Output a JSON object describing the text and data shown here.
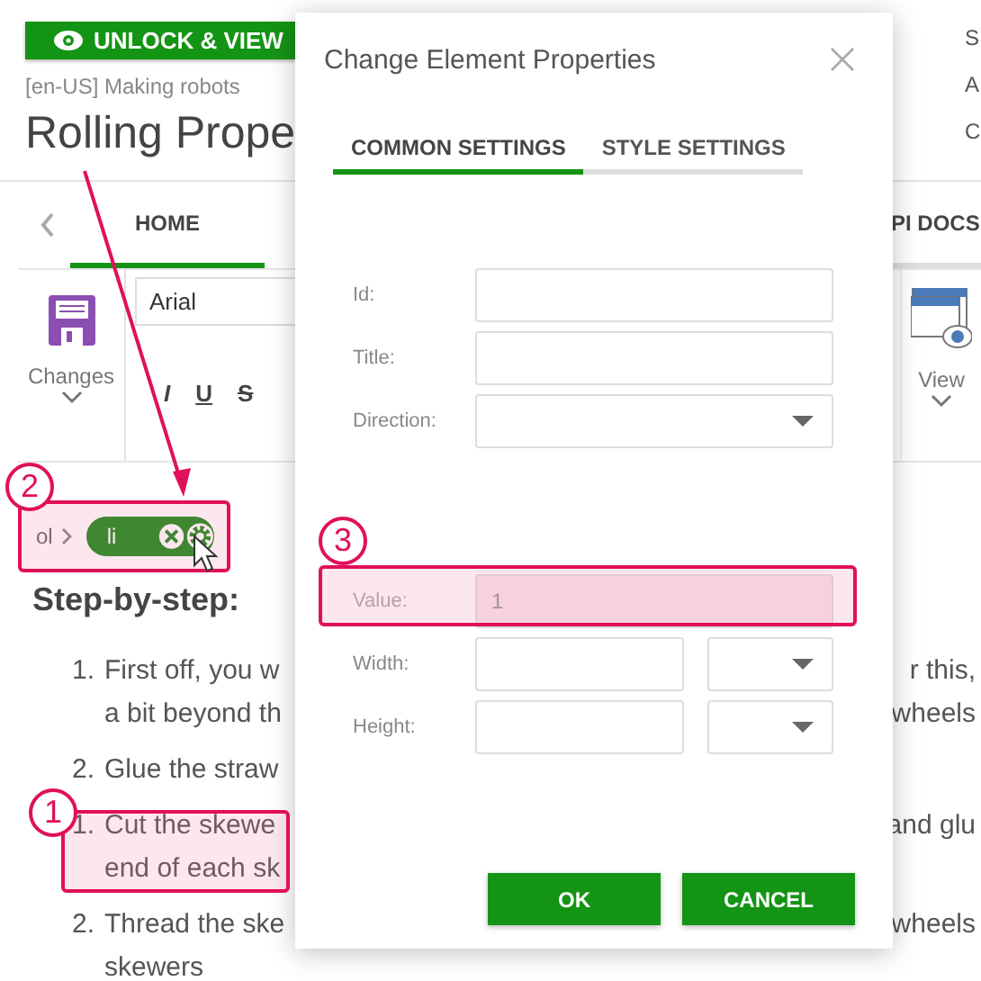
{
  "header": {
    "unlock_button": "UNLOCK & VIEW",
    "path": "[en-US] Making robots",
    "title": "Rolling Prope",
    "side_letters": [
      "S",
      "A",
      "C"
    ]
  },
  "ribbon": {
    "tabs": [
      {
        "label": "HOME",
        "selected": true
      },
      {
        "label": "PI DOCS",
        "selected": false
      }
    ],
    "save_label": "Changes",
    "font": "Arial",
    "format_buttons": [
      {
        "label": "I",
        "kind": "italic"
      },
      {
        "label": "U",
        "kind": "underline"
      },
      {
        "label": "S",
        "kind": "strike"
      }
    ],
    "view_label": "View"
  },
  "element_path": {
    "parent": "ol",
    "current": "li"
  },
  "content": {
    "heading": "Step-by-step:",
    "lines": [
      {
        "number": "1.",
        "left": "First off, you w",
        "right": "r this,"
      },
      {
        "left": "a bit beyond th",
        "right": "wheels"
      },
      {
        "number": "2.",
        "left": "Glue the straw"
      },
      {
        "number": "1.",
        "left": "Cut the skewe",
        "right": "and glu"
      },
      {
        "left": "end of each sk"
      },
      {
        "number": "2.",
        "left": "Thread the ske",
        "right": "wheels"
      },
      {
        "left": "skewers"
      }
    ]
  },
  "dialog": {
    "title": "Change Element Properties",
    "tabs": [
      {
        "label": "COMMON SETTINGS",
        "selected": true
      },
      {
        "label": "STYLE SETTINGS",
        "selected": false
      }
    ],
    "sections": [
      [
        {
          "label": "Id:",
          "kind": "text"
        },
        {
          "label": "Title:",
          "kind": "text"
        },
        {
          "label": "Direction:",
          "kind": "select"
        }
      ],
      [
        {
          "label": "Value:",
          "kind": "text",
          "value": "1",
          "disabled": true
        },
        {
          "label": "Width:",
          "kind": "unit",
          "disabled": false
        },
        {
          "label": "Height:",
          "kind": "unit",
          "disabled": false
        }
      ]
    ],
    "buttons": [
      "OK",
      "CANCEL"
    ]
  },
  "annotations": [
    {
      "number": "1"
    },
    {
      "number": "2"
    },
    {
      "number": "3"
    }
  ]
}
